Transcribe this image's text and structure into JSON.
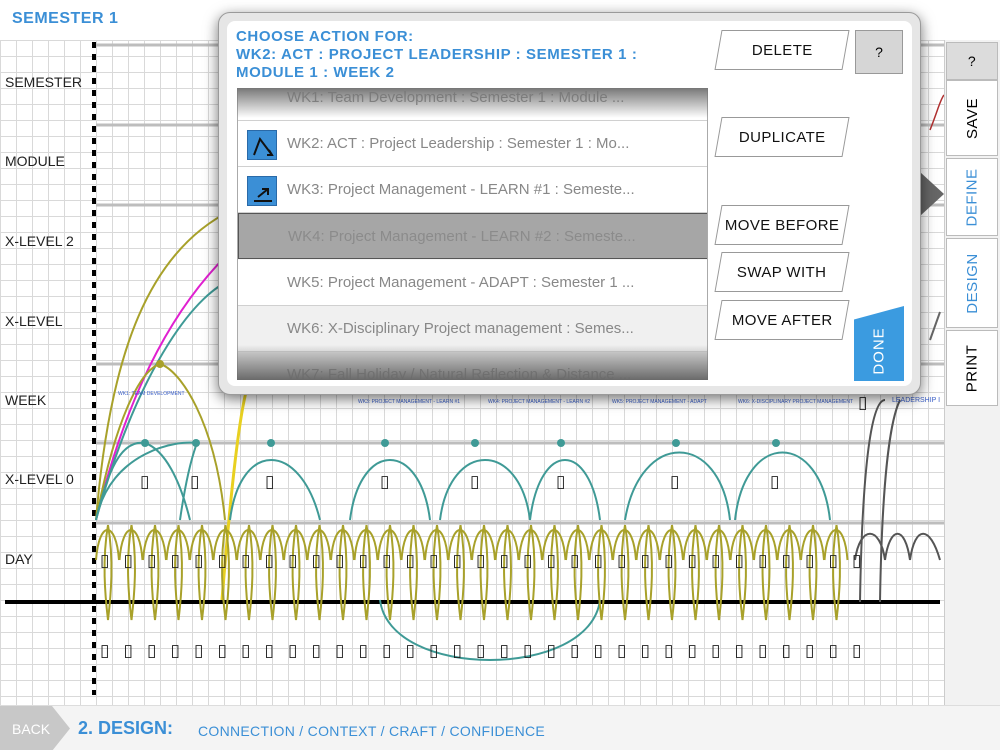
{
  "header": {
    "title": "SEMESTER 1"
  },
  "rows": [
    "SEMESTER",
    "MODULE",
    "X-LEVEL 2",
    "X-LEVEL",
    "WEEK",
    "X-LEVEL 0",
    "DAY"
  ],
  "week_labels": [
    "WK1: TEAM DEVELOPMENT",
    "WK3: PROJECT MANAGEMENT - LEARN #1",
    "WK4: PROJECT MANAGEMENT - LEARN #2",
    "WK5: PROJECT MANAGEMENT - ADAPT",
    "WK6: X-DISCIPLINARY PROJECT MANAGEMENT",
    "LEADERSHIP I"
  ],
  "modal": {
    "heading_line1": "CHOOSE ACTION FOR:",
    "heading_line2": "WK2: ACT : PROJECT LEADERSHIP : SEMESTER 1 :",
    "heading_line3": "MODULE 1 : WEEK 2",
    "items": [
      {
        "label": "WK1: Team Development : Semester 1 : Module ...",
        "icon": ""
      },
      {
        "label": "WK2: ACT : Project Leadership : Semester 1 : Mo...",
        "icon": "triangle-cycle-icon"
      },
      {
        "label": "WK3: Project Management - LEARN #1 : Semeste...",
        "icon": "arrow-up-right-icon"
      },
      {
        "label": "WK4: Project Management - LEARN #2 : Semeste...",
        "icon": ""
      },
      {
        "label": "WK5: Project Management - ADAPT : Semester 1 ...",
        "icon": ""
      },
      {
        "label": "WK6: X-Disciplinary Project management : Semes...",
        "icon": ""
      },
      {
        "label": "WK7: Fall Holiday / Natural Reflection & Distance ...",
        "icon": ""
      }
    ],
    "actions": {
      "delete": "DELETE",
      "duplicate": "DUPLICATE",
      "move_before": "MOVE BEFORE",
      "swap_with": "SWAP WITH",
      "move_after": "MOVE AFTER",
      "help": "?",
      "done": "DONE"
    }
  },
  "tabs": {
    "help": "?",
    "save": "SAVE",
    "define": "DEFINE",
    "design": "DESIGN",
    "print": "PRINT"
  },
  "footer": {
    "back": "BACK",
    "title": "2. DESIGN:",
    "subtitle": "CONNECTION / CONTEXT / CRAFT / CONFIDENCE"
  },
  "colors": {
    "accent": "#3b8fd6",
    "teal": "#3f9a96",
    "olive": "#a8a12a",
    "magenta": "#e020d0"
  },
  "glyph": "▯"
}
